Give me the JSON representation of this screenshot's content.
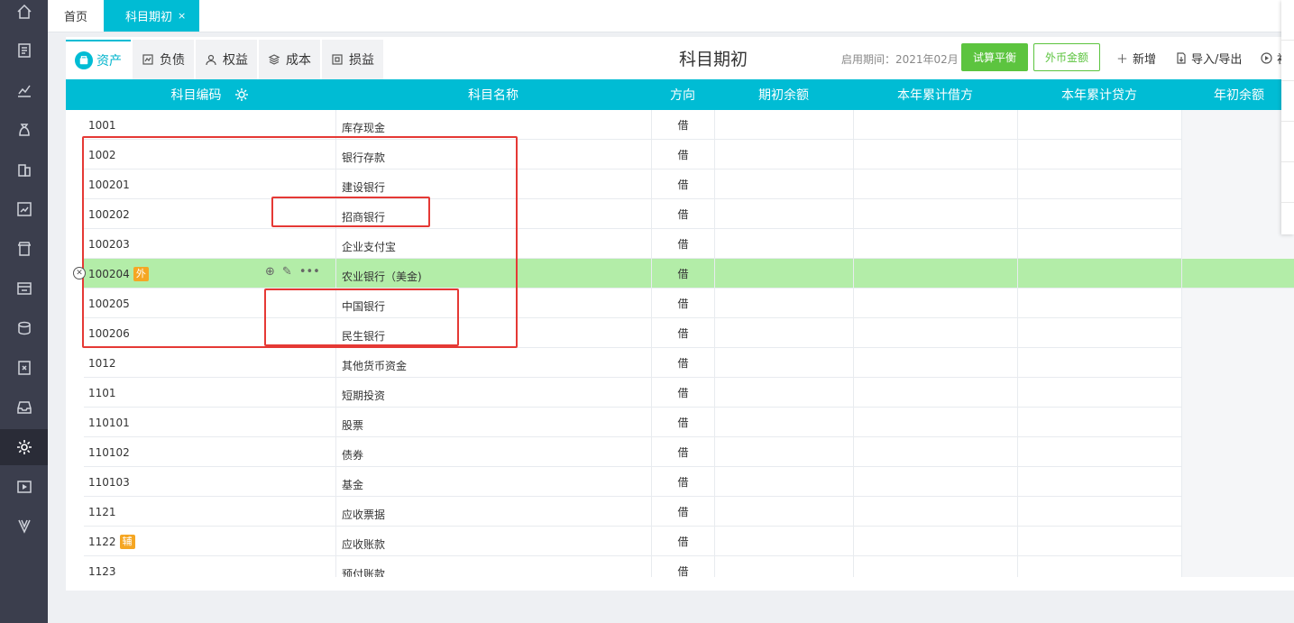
{
  "sidebar": {
    "items": [
      {
        "icon": "home-icon"
      },
      {
        "icon": "voucher-icon"
      },
      {
        "icon": "chart-icon"
      },
      {
        "icon": "money-bag-icon"
      },
      {
        "icon": "building-icon"
      },
      {
        "icon": "report-icon"
      },
      {
        "icon": "shop-icon"
      },
      {
        "icon": "invoice-icon"
      },
      {
        "icon": "coins-icon"
      },
      {
        "icon": "tax-icon"
      },
      {
        "icon": "inbox-icon"
      },
      {
        "icon": "settings-icon"
      },
      {
        "icon": "video-icon"
      },
      {
        "icon": "v-logo-icon"
      }
    ],
    "active_index": 11
  },
  "tabs": {
    "home": "首页",
    "active": "科目期初",
    "active_close": "×"
  },
  "categories": [
    {
      "label": "资产",
      "icon": "asset-icon",
      "active": true
    },
    {
      "label": "负债",
      "icon": "liability-icon",
      "active": false
    },
    {
      "label": "权益",
      "icon": "equity-icon",
      "active": false
    },
    {
      "label": "成本",
      "icon": "cost-icon",
      "active": false
    },
    {
      "label": "损益",
      "icon": "profit-loss-icon",
      "active": false
    }
  ],
  "header": {
    "title": "科目期初",
    "period": "启用期间：2021年02月",
    "trial_balance": "试算平衡",
    "fx_amount": "外币金额",
    "add": "新增",
    "import_export": "导入/导出",
    "more_partial": "初"
  },
  "columns": [
    "科目编码",
    "科目名称",
    "方向",
    "期初余额",
    "本年累计借方",
    "本年累计贷方",
    "年初余额"
  ],
  "rows": [
    {
      "code": "1001",
      "name": "库存现金",
      "dir": "借"
    },
    {
      "code": "1002",
      "name": "银行存款",
      "dir": "借"
    },
    {
      "code": "100201",
      "name": "建设银行",
      "dir": "借"
    },
    {
      "code": "100202",
      "name": "招商银行",
      "dir": "借"
    },
    {
      "code": "100203",
      "name": "企业支付宝",
      "dir": "借"
    },
    {
      "code": "100204",
      "name": "农业银行（美金)",
      "dir": "借",
      "badge": "外",
      "highlight": true
    },
    {
      "code": "100205",
      "name": "中国银行",
      "dir": "借"
    },
    {
      "code": "100206",
      "name": "民生银行",
      "dir": "借"
    },
    {
      "code": "1012",
      "name": "其他货币资金",
      "dir": "借"
    },
    {
      "code": "1101",
      "name": "短期投资",
      "dir": "借"
    },
    {
      "code": "110101",
      "name": "股票",
      "dir": "借"
    },
    {
      "code": "110102",
      "name": "债券",
      "dir": "借"
    },
    {
      "code": "110103",
      "name": "基金",
      "dir": "借"
    },
    {
      "code": "1121",
      "name": "应收票据",
      "dir": "借"
    },
    {
      "code": "1122",
      "name": "应收账款",
      "dir": "借",
      "badge": "辅"
    },
    {
      "code": "1123",
      "name": "预付账款",
      "dir": "借"
    }
  ],
  "colors": {
    "accent": "#00bcd4",
    "green": "#5cc43f",
    "highlight_row": "#b3eda8",
    "badge": "#f5a623",
    "annotation": "#e53935"
  }
}
